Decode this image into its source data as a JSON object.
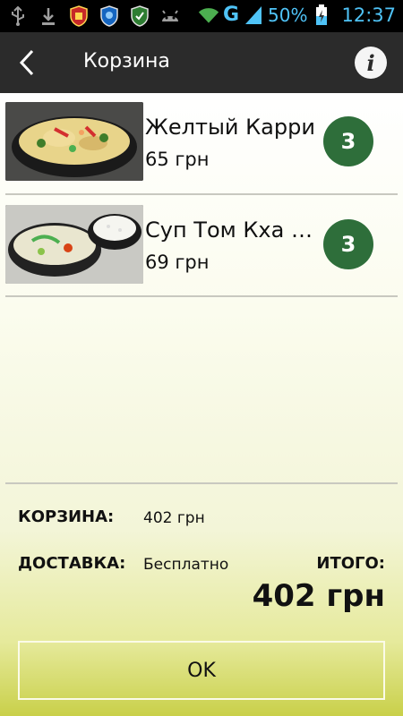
{
  "status_bar": {
    "battery": "50%",
    "network": "G",
    "time": "12:37",
    "icons": [
      "usb-icon",
      "download-icon",
      "shield-app-icon",
      "shield-blue-icon",
      "shield-green-icon",
      "android-icon",
      "wifi-icon",
      "signal-icon",
      "battery-charging-icon"
    ]
  },
  "action_bar": {
    "title": "Корзина",
    "back_icon": "back-arrow-icon",
    "info_icon": "info-icon"
  },
  "cart": {
    "items": [
      {
        "name": "Желтый Карри",
        "price": "65 грн",
        "quantity": "3",
        "image": "yellow-curry-dish"
      },
      {
        "name": "Суп Том Кха Кай",
        "price": "69 грн",
        "quantity": "3",
        "image": "tom-kha-soup-with-rice"
      }
    ]
  },
  "summary": {
    "cart_label": "КОРЗИНА:",
    "cart_value": "402 грн",
    "delivery_label": "ДОСТАВКА:",
    "delivery_value": "Бесплатно",
    "total_label": "ИТОГО:",
    "total_value": "402 грн"
  },
  "ok_button": {
    "label": "OK"
  },
  "colors": {
    "status_accent": "#4fc3f7",
    "action_bar_bg": "#2b2b2b",
    "qty_badge": "#2e6e3a",
    "bottom_gradient": "#c9d04a"
  }
}
